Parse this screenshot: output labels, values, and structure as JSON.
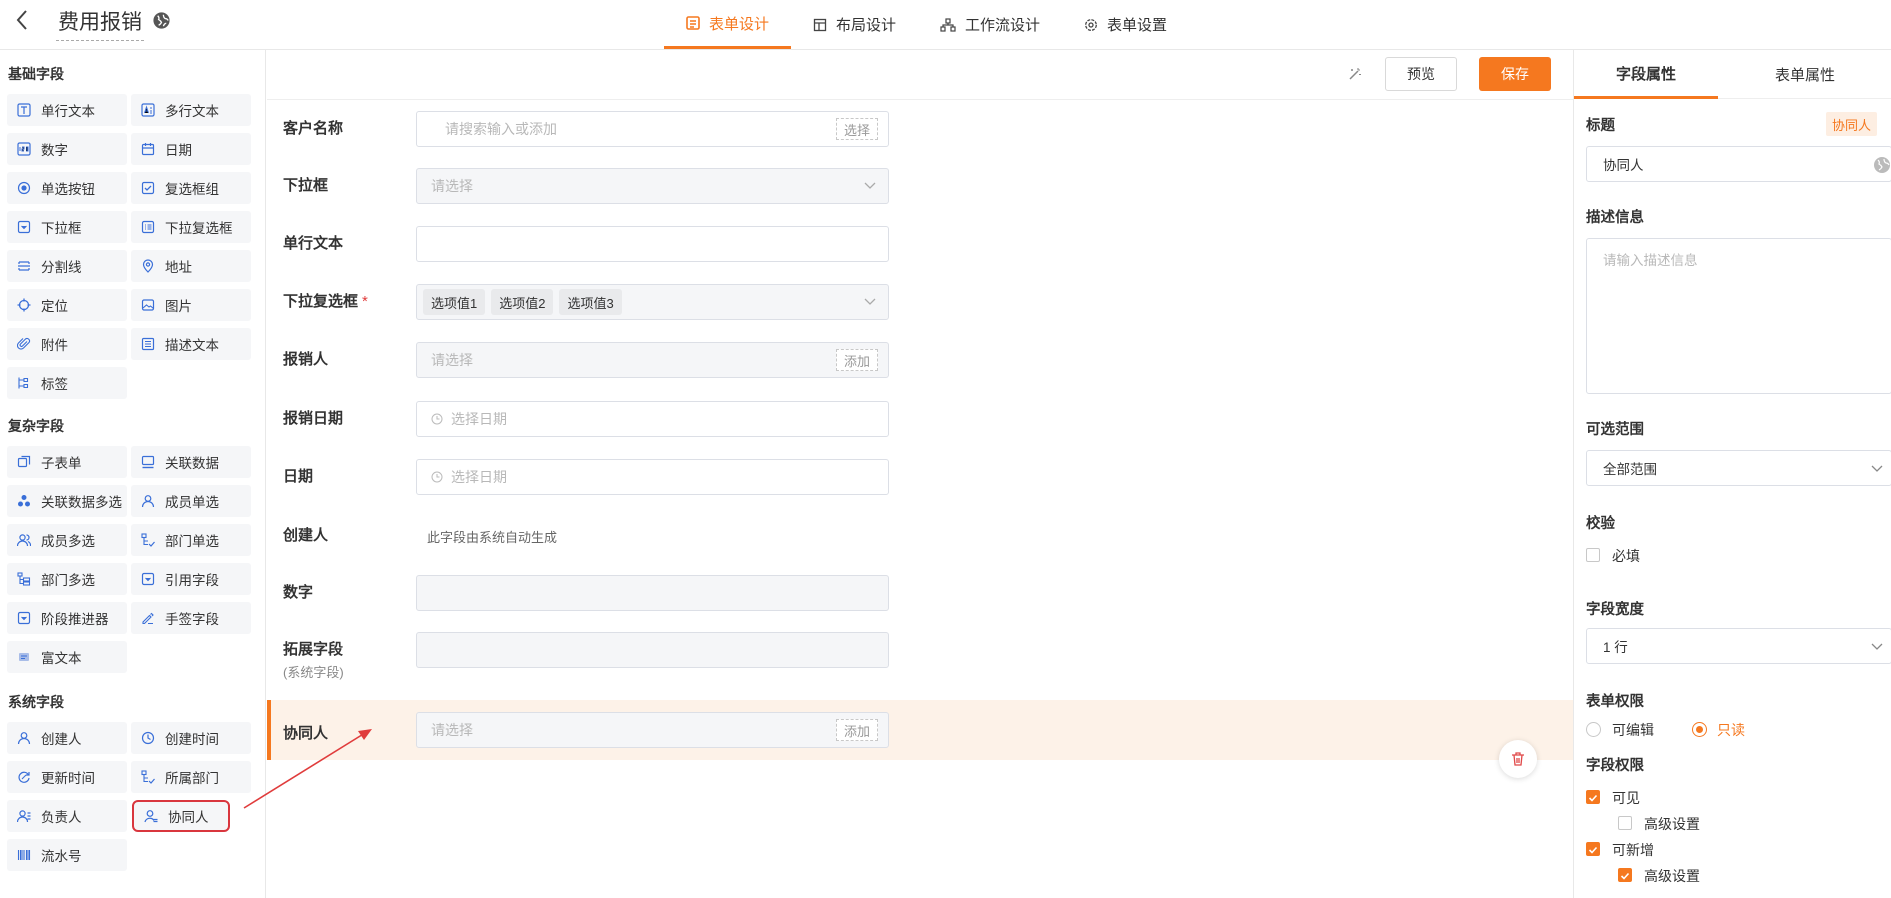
{
  "header": {
    "title": "费用报销",
    "tabs": [
      {
        "label": "表单设计",
        "icon": "form-icon",
        "active": true
      },
      {
        "label": "布局设计",
        "icon": "layout-icon",
        "active": false
      },
      {
        "label": "工作流设计",
        "icon": "workflow-icon",
        "active": false
      },
      {
        "label": "表单设置",
        "icon": "settings-icon",
        "active": false
      }
    ]
  },
  "left_panel": {
    "groups": [
      {
        "title": "基础字段",
        "items": [
          {
            "label": "单行文本",
            "icon": "text-icon"
          },
          {
            "label": "多行文本",
            "icon": "multiline-text-icon"
          },
          {
            "label": "数字",
            "icon": "number-icon"
          },
          {
            "label": "日期",
            "icon": "calendar-icon"
          },
          {
            "label": "单选按钮",
            "icon": "radio-icon"
          },
          {
            "label": "复选框组",
            "icon": "checkbox-icon"
          },
          {
            "label": "下拉框",
            "icon": "dropdown-icon"
          },
          {
            "label": "下拉复选框",
            "icon": "dropdown-multi-icon"
          },
          {
            "label": "分割线",
            "icon": "divider-icon"
          },
          {
            "label": "地址",
            "icon": "location-pin-icon"
          },
          {
            "label": "定位",
            "icon": "crosshair-icon"
          },
          {
            "label": "图片",
            "icon": "image-icon"
          },
          {
            "label": "附件",
            "icon": "paperclip-icon"
          },
          {
            "label": "描述文本",
            "icon": "description-icon"
          },
          {
            "label": "标签",
            "icon": "tag-icon"
          }
        ]
      },
      {
        "title": "复杂字段",
        "items": [
          {
            "label": "子表单",
            "icon": "subform-icon"
          },
          {
            "label": "关联数据",
            "icon": "link-data-icon"
          },
          {
            "label": "关联数据多选",
            "icon": "link-multi-icon"
          },
          {
            "label": "成员单选",
            "icon": "user-icon"
          },
          {
            "label": "成员多选",
            "icon": "users-icon"
          },
          {
            "label": "部门单选",
            "icon": "dept-icon"
          },
          {
            "label": "部门多选",
            "icon": "dept-multi-icon"
          },
          {
            "label": "引用字段",
            "icon": "reference-icon"
          },
          {
            "label": "阶段推进器",
            "icon": "stage-icon"
          },
          {
            "label": "手签字段",
            "icon": "signature-icon"
          },
          {
            "label": "富文本",
            "icon": "richtext-icon"
          }
        ]
      },
      {
        "title": "系统字段",
        "items": [
          {
            "label": "创建人",
            "icon": "user-icon"
          },
          {
            "label": "创建时间",
            "icon": "clock-icon"
          },
          {
            "label": "更新时间",
            "icon": "refresh-icon"
          },
          {
            "label": "所属部门",
            "icon": "dept-icon"
          },
          {
            "label": "负责人",
            "icon": "owner-icon"
          },
          {
            "label": "协同人",
            "icon": "collaborator-icon"
          },
          {
            "label": "流水号",
            "icon": "barcode-icon"
          }
        ]
      }
    ]
  },
  "toolbar": {
    "preview_label": "预览",
    "save_label": "保存"
  },
  "form": {
    "fields": [
      {
        "label": "客户名称",
        "placeholder": "请搜索输入或添加",
        "button": "选择"
      },
      {
        "label": "下拉框",
        "placeholder": "请选择"
      },
      {
        "label": "单行文本",
        "placeholder": ""
      },
      {
        "label": "下拉复选框",
        "required_mark": "*",
        "tags": [
          "选项值1",
          "选项值2",
          "选项值3"
        ]
      },
      {
        "label": "报销人",
        "placeholder": "请选择",
        "button": "添加"
      },
      {
        "label": "报销日期",
        "placeholder": "选择日期"
      },
      {
        "label": "日期",
        "placeholder": "选择日期"
      },
      {
        "label": "创建人",
        "note": "此字段由系统自动生成"
      },
      {
        "label": "数字",
        "placeholder": ""
      },
      {
        "label": "拓展字段",
        "sublabel": "(系统字段)",
        "placeholder": ""
      },
      {
        "label": "协同人",
        "placeholder": "请选择",
        "button": "添加",
        "selected": true
      }
    ]
  },
  "right_panel": {
    "tabs": [
      {
        "label": "字段属性",
        "active": true
      },
      {
        "label": "表单属性",
        "active": false
      }
    ],
    "title_label": "标题",
    "title_badge": "协同人",
    "title_value": "协同人",
    "desc_label": "描述信息",
    "desc_placeholder": "请输入描述信息",
    "range_label": "可选范围",
    "range_value": "全部范围",
    "validate_label": "校验",
    "required_label": "必填",
    "required_checked": false,
    "width_label": "字段宽度",
    "width_value": "1 行",
    "form_perm_label": "表单权限",
    "perm_options": [
      {
        "label": "可编辑",
        "checked": false
      },
      {
        "label": "只读",
        "checked": true
      }
    ],
    "field_perm_label": "字段权限",
    "visible_label": "可见",
    "visible_checked": true,
    "advanced_label": "高级设置",
    "visible_advanced_checked": false,
    "addable_label": "可新增",
    "addable_checked": true,
    "addable_advanced_checked": true,
    "accent_color": "#f5781f"
  }
}
